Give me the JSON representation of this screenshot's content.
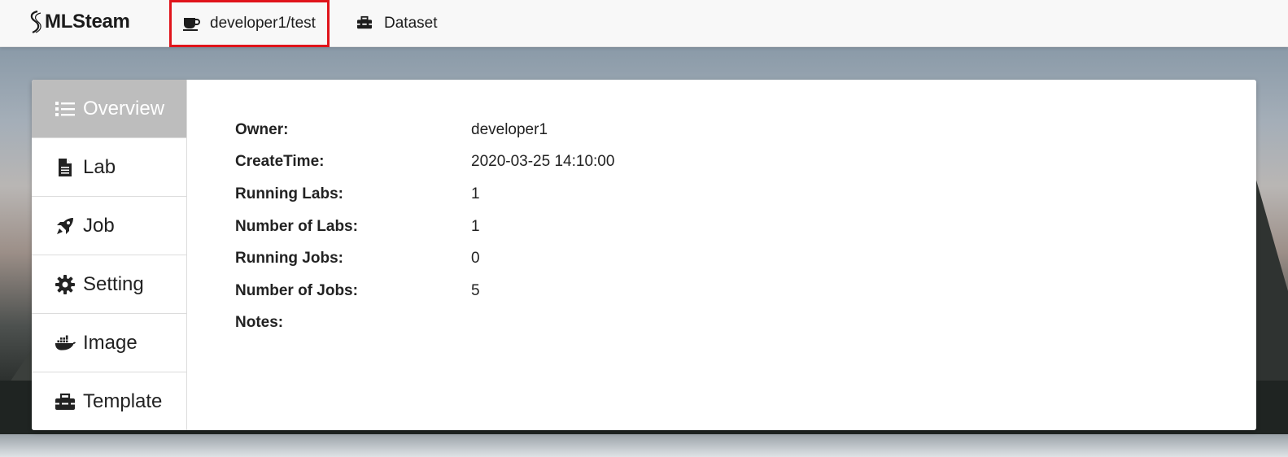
{
  "brand": {
    "name": "MLSteam"
  },
  "navbar": {
    "project": {
      "label": "developer1/test",
      "icon": "coffee-icon"
    },
    "dataset": {
      "label": "Dataset",
      "icon": "toolbox-icon"
    }
  },
  "sidebar": {
    "items": [
      {
        "label": "Overview",
        "icon": "list-icon",
        "active": true
      },
      {
        "label": "Lab",
        "icon": "file-icon"
      },
      {
        "label": "Job",
        "icon": "rocket-icon"
      },
      {
        "label": "Setting",
        "icon": "gear-icon"
      },
      {
        "label": "Image",
        "icon": "docker-icon"
      },
      {
        "label": "Template",
        "icon": "toolbox-icon"
      }
    ]
  },
  "overview": {
    "fields": [
      {
        "key": "Owner:",
        "value": "developer1"
      },
      {
        "key": "CreateTime:",
        "value": "2020-03-25 14:10:00"
      },
      {
        "key": "Running Labs:",
        "value": "1"
      },
      {
        "key": "Number of Labs:",
        "value": "1"
      },
      {
        "key": "Running Jobs:",
        "value": "0"
      },
      {
        "key": "Number of Jobs:",
        "value": "5"
      },
      {
        "key": "Notes:",
        "value": ""
      }
    ]
  },
  "colors": {
    "highlight_border": "#e0141b",
    "active_tab_bg": "#bdbdbd",
    "navbar_bg": "#f8f8f8"
  }
}
